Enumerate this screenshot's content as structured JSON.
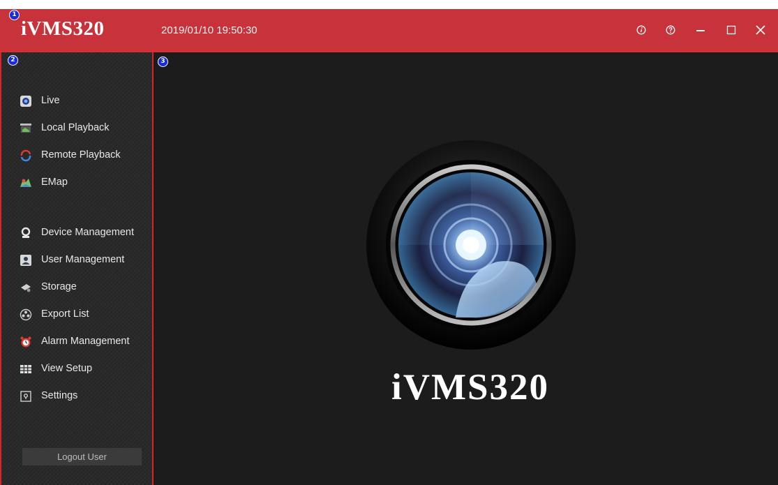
{
  "header": {
    "app_title": "iVMS320",
    "datetime": "2019/01/10 19:50:30",
    "buttons": [
      "info-icon",
      "help-icon",
      "minimize-icon",
      "maximize-icon",
      "close-icon"
    ]
  },
  "markers": [
    "1",
    "2",
    "3"
  ],
  "sidebar": {
    "items": [
      {
        "label": "Live",
        "icon": "live-icon"
      },
      {
        "label": "Local Playback",
        "icon": "local-playback-icon"
      },
      {
        "label": "Remote Playback",
        "icon": "remote-playback-icon"
      },
      {
        "label": "EMap",
        "icon": "emap-icon"
      },
      {
        "label": "Device Management",
        "icon": "device-management-icon"
      },
      {
        "label": "User Management",
        "icon": "user-management-icon"
      },
      {
        "label": "Storage",
        "icon": "storage-icon"
      },
      {
        "label": "Export List",
        "icon": "export-list-icon"
      },
      {
        "label": "Alarm Management",
        "icon": "alarm-icon"
      },
      {
        "label": "View Setup",
        "icon": "view-setup-icon"
      },
      {
        "label": "Settings",
        "icon": "settings-icon"
      }
    ],
    "logout_label": "Logout User"
  },
  "main": {
    "brand_text": "iVMS320"
  },
  "colors": {
    "titlebar": "#c8323a",
    "border_accent": "#d8252b",
    "sidebar_bg": "#2a2a2a",
    "main_bg": "#1c1c1c"
  }
}
